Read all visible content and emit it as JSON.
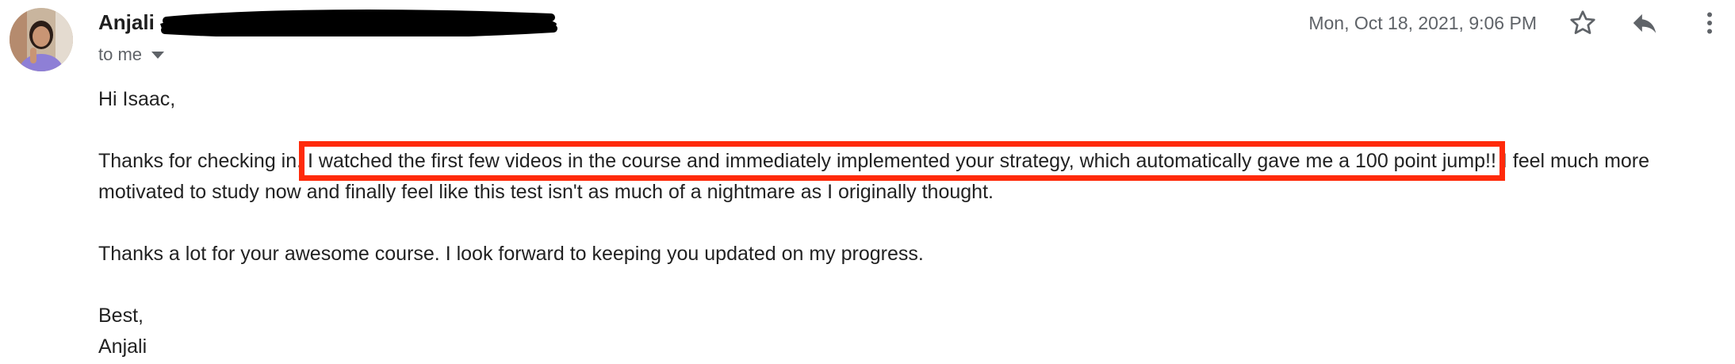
{
  "sender": {
    "name": "Anjali",
    "recipient": "to me",
    "date": "Mon, Oct 18, 2021, 9:06 PM"
  },
  "icons": {
    "avatar": "avatar",
    "redaction": "redaction-scribble",
    "recipient_caret": "caret-down-icon",
    "star": "star-icon",
    "reply": "reply-icon",
    "more": "more-vert-icon"
  },
  "message": {
    "greeting": "Hi Isaac,",
    "para2_before": "Thanks for checking in. ",
    "para2_highlight": "I watched the first few videos in the course and immediately implemented your strategy, which automatically gave me a 100 point jump!!",
    "para2_after": " I feel much more motivated to study now and finally feel like this test isn't as much of a nightmare as I originally thought.",
    "para3": "Thanks a lot for your awesome course. I look forward to keeping you updated on my progress.",
    "closing": "Best,",
    "signature": "Anjali"
  },
  "colors": {
    "highlight_border": "#ff2a0a",
    "redaction": "#000000",
    "muted_text": "#5f6368"
  }
}
